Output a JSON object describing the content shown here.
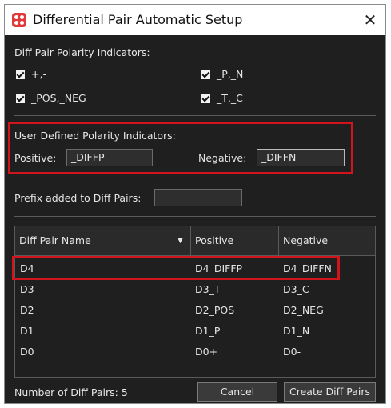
{
  "window": {
    "title": "Differential Pair Automatic Setup",
    "close_glyph": "✕"
  },
  "polarity": {
    "heading": "Diff Pair Polarity Indicators:",
    "options": [
      {
        "label": "+,-",
        "checked": true
      },
      {
        "label": "_P,_N",
        "checked": true
      },
      {
        "label": "_POS,_NEG",
        "checked": true
      },
      {
        "label": "_T,_C",
        "checked": true
      }
    ]
  },
  "user_defined": {
    "heading": "User Defined Polarity Indicators:",
    "positive_label": "Positive:",
    "positive_value": "_DIFFP",
    "negative_label": "Negative:",
    "negative_value": "_DIFFN"
  },
  "prefix": {
    "label": "Prefix added to Diff Pairs:",
    "value": ""
  },
  "table": {
    "columns": [
      "Diff Pair Name",
      "Positive",
      "Negative"
    ],
    "rows": [
      {
        "name": "D4",
        "positive": "D4_DIFFP",
        "negative": "D4_DIFFN"
      },
      {
        "name": "D3",
        "positive": "D3_T",
        "negative": "D3_C"
      },
      {
        "name": "D2",
        "positive": "D2_POS",
        "negative": "D2_NEG"
      },
      {
        "name": "D1",
        "positive": "D1_P",
        "negative": "D1_N"
      },
      {
        "name": "D0",
        "positive": "D0+",
        "negative": "D0-"
      }
    ]
  },
  "footer": {
    "count_label": "Number of Diff Pairs: 5",
    "cancel_label": "Cancel",
    "create_label": "Create Diff Pairs"
  },
  "colors": {
    "highlight": "#d4141c",
    "background": "#1f1f1f",
    "icon": "#e23a3a"
  }
}
